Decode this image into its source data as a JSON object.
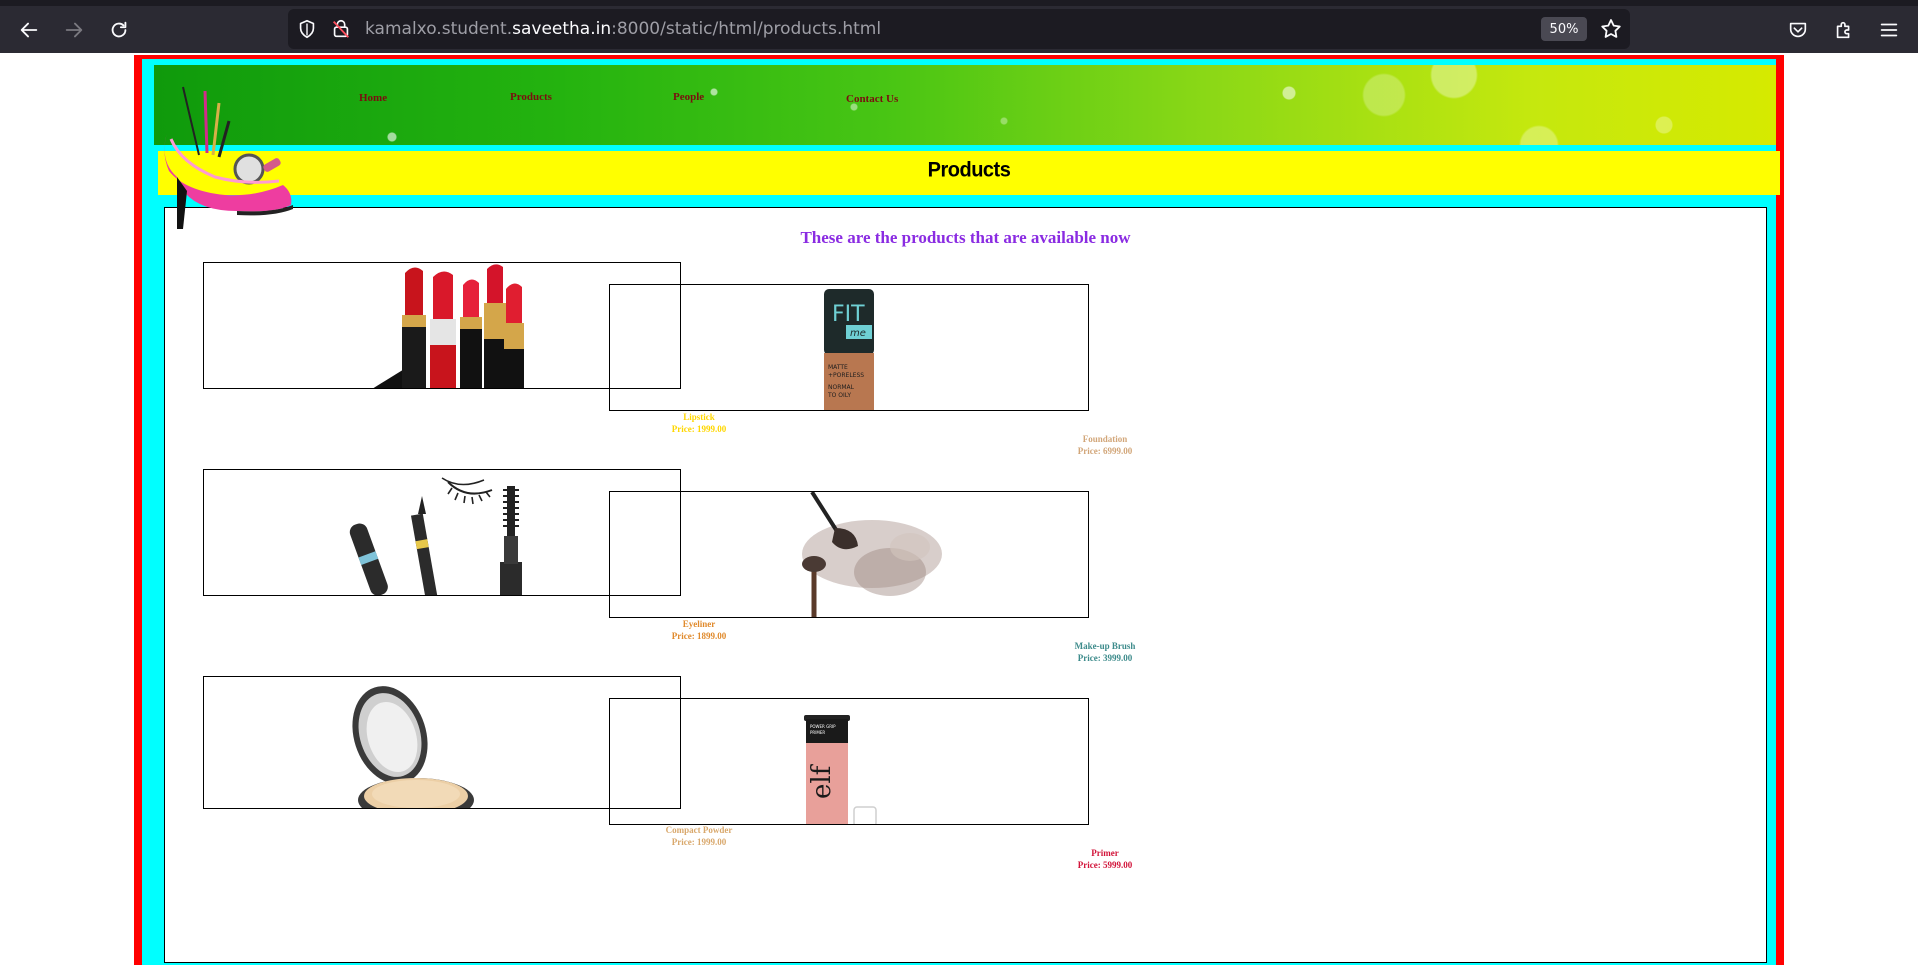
{
  "browser": {
    "url_prefix": "kamalxo.student.",
    "url_host": "saveetha.in",
    "url_suffix": ":8000/static/html/products.html",
    "zoom": "50%"
  },
  "nav": {
    "home": "Home",
    "products": "Products",
    "people": "People",
    "contact": "Contact Us"
  },
  "page": {
    "title": "Products",
    "subtitle": "These are the products that are available now"
  },
  "products": [
    {
      "name": "Lipstick",
      "price": "Price: 1999.00",
      "color": "#ffd700"
    },
    {
      "name": "Foundation",
      "price": "Price: 6999.00",
      "color": "#d2a679"
    },
    {
      "name": "Eyeliner",
      "price": "Price: 1899.00",
      "color": "#e08a2c"
    },
    {
      "name": "Make-up Brush",
      "price": "Price: 3999.00",
      "color": "#3d8b8b"
    },
    {
      "name": "Compact Powder",
      "price": "Price: 1999.00",
      "color": "#d9a86c"
    },
    {
      "name": "Primer",
      "price": "Price: 5999.00",
      "color": "#d2143a"
    }
  ],
  "colors": {
    "frame": "#ff0000",
    "inner": "#00ffff",
    "title_bar": "#ffff00",
    "subtitle": "#8a2be2"
  }
}
